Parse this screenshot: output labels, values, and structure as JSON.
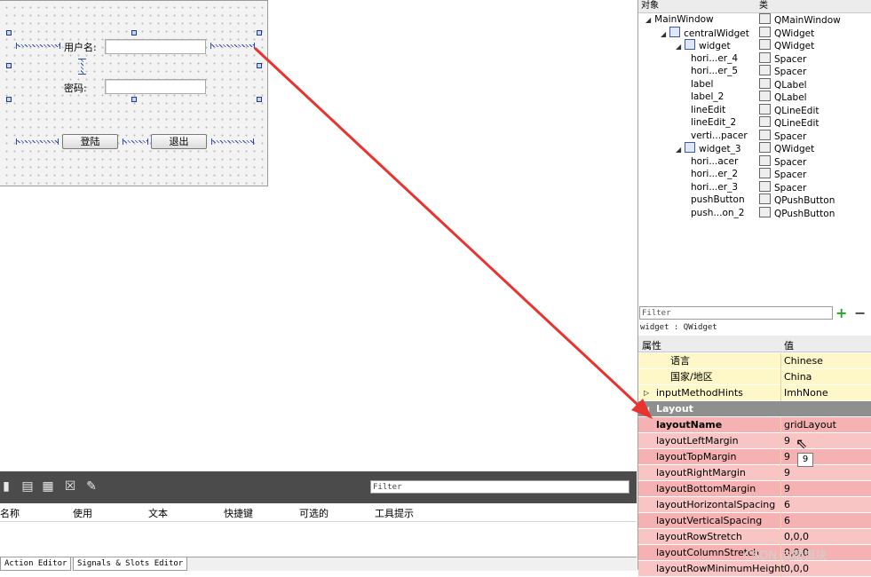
{
  "form": {
    "username_label": "用户名:",
    "password_label": "密码:",
    "login_button": "登陆",
    "exit_button": "退出"
  },
  "object_inspector": {
    "headers": {
      "object": "对象",
      "class": "类"
    },
    "rows": [
      {
        "name": "MainWindow",
        "class": "QMainWindow",
        "level": 0,
        "expanded": true
      },
      {
        "name": "centralWidget",
        "class": "QWidget",
        "level": 1,
        "expanded": true
      },
      {
        "name": "widget",
        "class": "QWidget",
        "level": 2,
        "expanded": true
      },
      {
        "name": "hori...er_4",
        "class": "Spacer",
        "level": 3
      },
      {
        "name": "hori...er_5",
        "class": "Spacer",
        "level": 3
      },
      {
        "name": "label",
        "class": "QLabel",
        "level": 3
      },
      {
        "name": "label_2",
        "class": "QLabel",
        "level": 3
      },
      {
        "name": "lineEdit",
        "class": "QLineEdit",
        "level": 3
      },
      {
        "name": "lineEdit_2",
        "class": "QLineEdit",
        "level": 3
      },
      {
        "name": "verti...pacer",
        "class": "Spacer",
        "level": 3
      },
      {
        "name": "widget_3",
        "class": "QWidget",
        "level": 2,
        "expanded": true
      },
      {
        "name": "hori...acer",
        "class": "Spacer",
        "level": 3
      },
      {
        "name": "hori...er_2",
        "class": "Spacer",
        "level": 3
      },
      {
        "name": "hori...er_3",
        "class": "Spacer",
        "level": 3
      },
      {
        "name": "pushButton",
        "class": "QPushButton",
        "level": 3
      },
      {
        "name": "push...on_2",
        "class": "QPushButton",
        "level": 3
      }
    ]
  },
  "property_editor": {
    "filter_placeholder": "Filter",
    "context": "widget : QWidget",
    "headers": {
      "property": "属性",
      "value": "值"
    },
    "rows": [
      {
        "name": "语言",
        "value": "Chinese",
        "style": "yellow",
        "indent": 2
      },
      {
        "name": "国家/地区",
        "value": "China",
        "style": "yellow",
        "indent": 2
      },
      {
        "name": "inputMethodHints",
        "value": "ImhNone",
        "style": "yellow",
        "indent": 1,
        "toggle": "▷"
      },
      {
        "name": "Layout",
        "value": "",
        "style": "group",
        "indent": 1,
        "toggle": "◢"
      },
      {
        "name": "layoutName",
        "value": "gridLayout",
        "style": "pink-dk",
        "indent": 1,
        "bold": true
      },
      {
        "name": "layoutLeftMargin",
        "value": "9",
        "style": "pink",
        "indent": 1
      },
      {
        "name": "layoutTopMargin",
        "value": "9",
        "style": "pink-dk",
        "indent": 1
      },
      {
        "name": "layoutRightMargin",
        "value": "9",
        "style": "pink",
        "indent": 1
      },
      {
        "name": "layoutBottomMargin",
        "value": "9",
        "style": "pink-dk",
        "indent": 1
      },
      {
        "name": "layoutHorizontalSpacing",
        "value": "6",
        "style": "pink",
        "indent": 1
      },
      {
        "name": "layoutVerticalSpacing",
        "value": "6",
        "style": "pink-dk",
        "indent": 1
      },
      {
        "name": "layoutRowStretch",
        "value": "0,0,0",
        "style": "pink",
        "indent": 1
      },
      {
        "name": "layoutColumnStretch",
        "value": "0,0,0",
        "style": "pink-dk",
        "indent": 1
      },
      {
        "name": "layoutRowMinimumHeight",
        "value": "0,0,0",
        "style": "pink",
        "indent": 1
      }
    ],
    "tooltip": "9"
  },
  "action_editor": {
    "filter_placeholder": "Filter",
    "columns": [
      "名称",
      "使用",
      "文本",
      "快捷键",
      "可选的",
      "工具提示"
    ],
    "tabs": [
      "Action Editor",
      "Signals & Slots Editor"
    ]
  },
  "watermark": "CSDN @猿饵块",
  "colors": {
    "arrow": "#e8332e",
    "layout_group": "#8f8f8f",
    "property_pink": "#f9c4c4",
    "property_yellow": "#fef8c8"
  }
}
